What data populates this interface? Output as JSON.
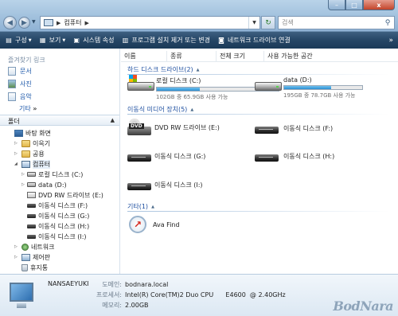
{
  "window": {
    "minimize_glyph": "–",
    "maximize_glyph": "□",
    "close_glyph": "x"
  },
  "address_bar": {
    "crumb": "컴퓨터",
    "separator": "▶",
    "dropdown_glyph": "▼"
  },
  "search": {
    "placeholder": "검색"
  },
  "toolbar": {
    "items": [
      {
        "label": "구성",
        "icon": "organize-icon",
        "has_dropdown": true
      },
      {
        "label": "보기",
        "icon": "views-icon",
        "has_dropdown": true
      },
      {
        "label": "시스템 속성",
        "icon": "system-properties-icon",
        "has_dropdown": false
      },
      {
        "label": "프로그램 설치 제거 또는 변경",
        "icon": "uninstall-icon",
        "has_dropdown": false
      },
      {
        "label": "네트워크 드라이브 연결",
        "icon": "map-network-drive-icon",
        "has_dropdown": false
      }
    ],
    "more_glyph": "»"
  },
  "sidebar": {
    "favorites_header": "즐겨찾기 링크",
    "favorites": [
      {
        "label": "문서",
        "icon": "documents-icon"
      },
      {
        "label": "사진",
        "icon": "pictures-icon"
      },
      {
        "label": "음악",
        "icon": "music-icon"
      }
    ],
    "more_label": "기타",
    "more_glyph": "»",
    "folders_header": "폴더",
    "folders_caret": "▲",
    "tree": [
      {
        "label": "바탕 화면",
        "icon": "desktop-icon",
        "level": 0
      },
      {
        "label": "이윽기",
        "icon": "user-folder-icon",
        "level": 1
      },
      {
        "label": "공용",
        "icon": "public-folder-icon",
        "level": 1
      },
      {
        "label": "컴퓨터",
        "icon": "computer-icon",
        "level": 1,
        "selected": true
      },
      {
        "label": "로컬 디스크 (C:)",
        "icon": "local-disk-icon",
        "level": 2
      },
      {
        "label": "data (D:)",
        "icon": "hard-drive-icon",
        "level": 2
      },
      {
        "label": "DVD RW 드라이브 (E:)",
        "icon": "dvd-drive-icon",
        "level": 2
      },
      {
        "label": "이동식 디스크 (F:)",
        "icon": "removable-disk-icon",
        "level": 2
      },
      {
        "label": "이동식 디스크 (G:)",
        "icon": "removable-disk-icon",
        "level": 2
      },
      {
        "label": "이동식 디스크 (H:)",
        "icon": "removable-disk-icon",
        "level": 2
      },
      {
        "label": "이동식 디스크 (I:)",
        "icon": "removable-disk-icon",
        "level": 2
      },
      {
        "label": "네트워크",
        "icon": "network-icon",
        "level": 1
      },
      {
        "label": "제어판",
        "icon": "control-panel-icon",
        "level": 1
      },
      {
        "label": "휴지통",
        "icon": "recycle-bin-icon",
        "level": 1
      }
    ]
  },
  "columns": [
    "이름",
    "종류",
    "전체 크기",
    "사용 가능한 공간"
  ],
  "groups": {
    "hard_disks": {
      "title": "하드 디스크 드라이브(2)",
      "items": [
        {
          "label": "로컬 디스크 (C:)",
          "status": "102GB 중 65.9GB 사용 가능",
          "used_fraction": 0.35
        },
        {
          "label": "data (D:)",
          "status": "195GB 중 78.7GB 사용 가능",
          "used_fraction": 0.6
        }
      ]
    },
    "removable": {
      "title": "이동식 미디어 장치(5)",
      "items": [
        {
          "label": "DVD RW 드라이브 (E:)",
          "icon": "dvd-drive-icon",
          "disc_label": "DVD"
        },
        {
          "label": "이동식 디스크 (F:)",
          "icon": "removable-disk-icon"
        },
        {
          "label": "이동식 디스크 (G:)",
          "icon": "removable-disk-icon"
        },
        {
          "label": "이동식 디스크 (H:)",
          "icon": "removable-disk-icon"
        },
        {
          "label": "이동식 디스크 (I:)",
          "icon": "removable-disk-icon"
        }
      ]
    },
    "other": {
      "title": "기타(1)",
      "items": [
        {
          "label": "Ava Find",
          "icon": "ava-find-icon"
        }
      ]
    }
  },
  "details": {
    "computer_name": "NANSAEYUKI",
    "rows": [
      {
        "key": "도메인:",
        "value": "bodnara.local"
      },
      {
        "key": "프로세서:",
        "value": "Intel(R) Core(TM)2 Duo CPU      E4600  @ 2.40GHz"
      },
      {
        "key": "메모리:",
        "value": "2.00GB"
      }
    ],
    "watermark": "BodNara"
  },
  "colors": {
    "toolbar_bg": "#254666",
    "link_blue": "#1a56a8",
    "group_title": "#1e4fa0",
    "bar_fill": "#2c8fd2"
  }
}
